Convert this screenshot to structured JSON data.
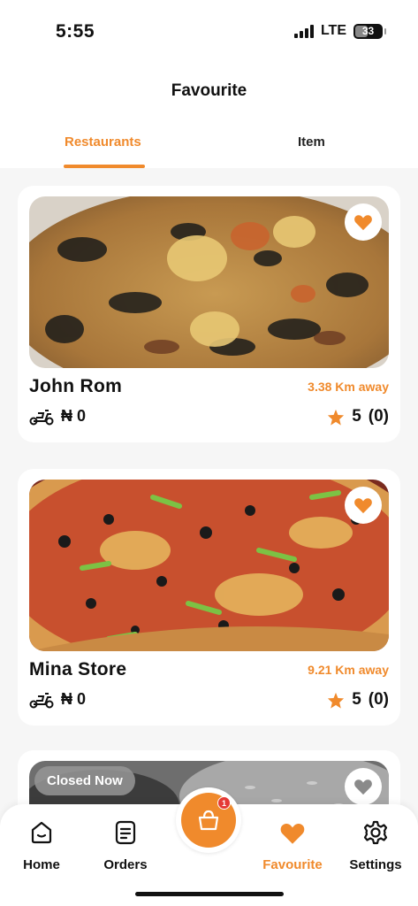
{
  "status": {
    "time": "5:55",
    "network": "LTE",
    "battery": "33"
  },
  "header": {
    "title": "Favourite",
    "tabs": [
      {
        "label": "Restaurants",
        "active": true
      },
      {
        "label": "Item",
        "active": false
      }
    ]
  },
  "cards": [
    {
      "name": "John Rom",
      "distance": "3.38 Km away",
      "fee": "₦ 0",
      "rating": "5",
      "count": "(0)",
      "image": "egusi-dish-photo"
    },
    {
      "name": "Mina Store",
      "distance": "9.21 Km away",
      "fee": "₦ 0",
      "rating": "5",
      "count": "(0)",
      "image": "pizza-photo"
    },
    {
      "badge": "Closed Now",
      "image": "rice-dish-photo"
    }
  ],
  "nav": {
    "items": [
      {
        "label": "Home",
        "icon": "home-icon"
      },
      {
        "label": "Orders",
        "icon": "orders-icon"
      },
      {
        "label": "Favourite",
        "icon": "heart-icon",
        "active": true
      },
      {
        "label": "Settings",
        "icon": "gear-icon"
      }
    ],
    "cart_badge": "1"
  },
  "colors": {
    "accent": "#f08a2c",
    "badge": "#e53935"
  }
}
